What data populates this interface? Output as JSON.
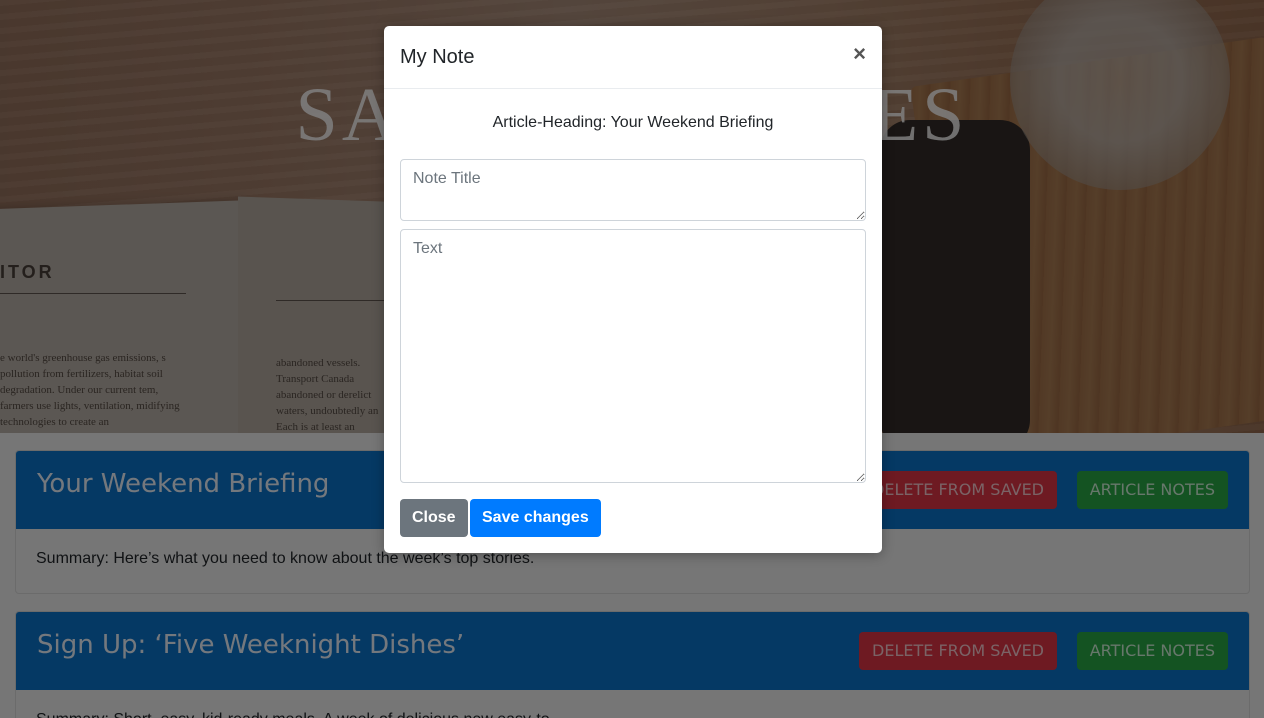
{
  "hero": {
    "title": "SAVED ARTICLES",
    "book_heading": "ITOR",
    "book_left_text": "e world's greenhouse gas emissions, s pollution from fertilizers, habitat soil degradation. Under our current tem, farmers use lights, ventilation, midifying technologies to create an",
    "book_right_text": "abandoned vessels. Transport Canada abandoned or derelict waters, undoubtedly an Each is at least an"
  },
  "articles": [
    {
      "title": "Your Weekend Briefing",
      "delete_label": "DELETE FROM SAVED",
      "notes_label": "ARTICLE NOTES",
      "summary": "Summary: Here’s what you need to know about the week’s top stories."
    },
    {
      "title": "Sign Up: ‘Five Weeknight Dishes’",
      "delete_label": "DELETE FROM SAVED",
      "notes_label": "ARTICLE NOTES",
      "summary": "Summary: Short, easy, kid-ready meals. A week of delicious new easy-to-"
    }
  ],
  "modal": {
    "title": "My Note",
    "close_glyph": "×",
    "article_heading": "Article-Heading: Your Weekend Briefing",
    "note_title_placeholder": "Note Title",
    "text_placeholder": "Text",
    "close_label": "Close",
    "save_label": "Save changes"
  },
  "colors": {
    "card_header": "#0b72c9",
    "delete_button": "#dc3545",
    "notes_button": "#28a745",
    "save_button": "#007bff",
    "close_button": "#6c757d"
  },
  "icons": {
    "modal_close": "close-icon"
  }
}
